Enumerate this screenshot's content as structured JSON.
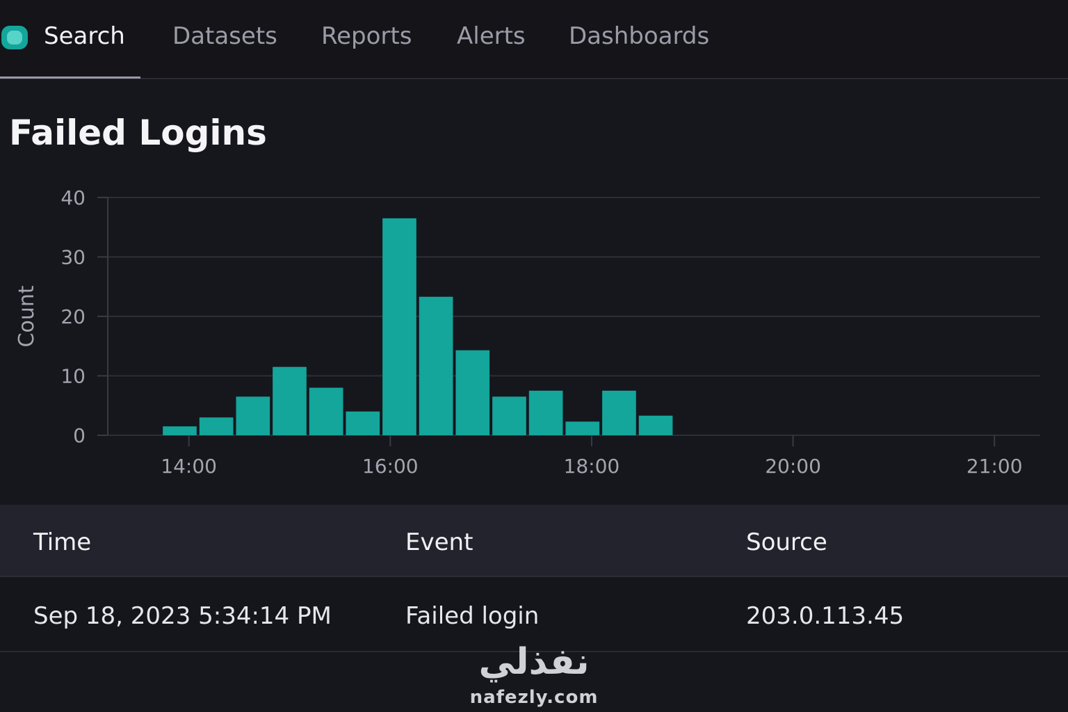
{
  "nav": {
    "tabs": [
      {
        "label": "Search",
        "active": true
      },
      {
        "label": "Datasets",
        "active": false
      },
      {
        "label": "Reports",
        "active": false
      },
      {
        "label": "Alerts",
        "active": false
      },
      {
        "label": "Dashboards",
        "active": false
      }
    ]
  },
  "page": {
    "title": "Failed Logins"
  },
  "colors": {
    "accent": "#14a59b",
    "grid": "#2e2e36",
    "axis": "#3a3a44",
    "tick_text": "#a4a4ae"
  },
  "chart_data": {
    "type": "bar",
    "title": "",
    "xlabel": "",
    "ylabel": "Count",
    "ylim": [
      0,
      40
    ],
    "yticks": [
      0,
      10,
      20,
      30,
      40
    ],
    "xlim": [
      "13:10",
      "21:45"
    ],
    "xticks": [
      "14:00",
      "16:00",
      "18:00",
      "20:00",
      "21:00"
    ],
    "bins": [
      {
        "start": "13:45",
        "end": "14:05",
        "value": 1.5
      },
      {
        "start": "14:05",
        "end": "14:25",
        "value": 3
      },
      {
        "start": "14:25",
        "end": "14:45",
        "value": 6.5
      },
      {
        "start": "14:45",
        "end": "15:05",
        "value": 11.5
      },
      {
        "start": "15:05",
        "end": "15:25",
        "value": 8
      },
      {
        "start": "15:25",
        "end": "15:45",
        "value": 4
      },
      {
        "start": "15:45",
        "end": "16:05",
        "value": 36.5
      },
      {
        "start": "16:05",
        "end": "16:25",
        "value": 23.3
      },
      {
        "start": "16:25",
        "end": "16:45",
        "value": 14.3
      },
      {
        "start": "16:45",
        "end": "17:05",
        "value": 6.5
      },
      {
        "start": "17:05",
        "end": "17:25",
        "value": 7.5
      },
      {
        "start": "17:25",
        "end": "17:45",
        "value": 2.3
      },
      {
        "start": "17:45",
        "end": "18:05",
        "value": 7.5
      },
      {
        "start": "18:05",
        "end": "18:25",
        "value": 3.3
      }
    ],
    "grid": true,
    "legend": "none"
  },
  "table": {
    "headers": [
      "Time",
      "Event",
      "Source"
    ],
    "rows": [
      [
        "Sep 18, 2023 5:34:14 PM",
        "Failed login",
        "203.0.113.45"
      ]
    ]
  },
  "watermark": {
    "arabic": "نفذلي",
    "domain": "nafezly.com"
  }
}
